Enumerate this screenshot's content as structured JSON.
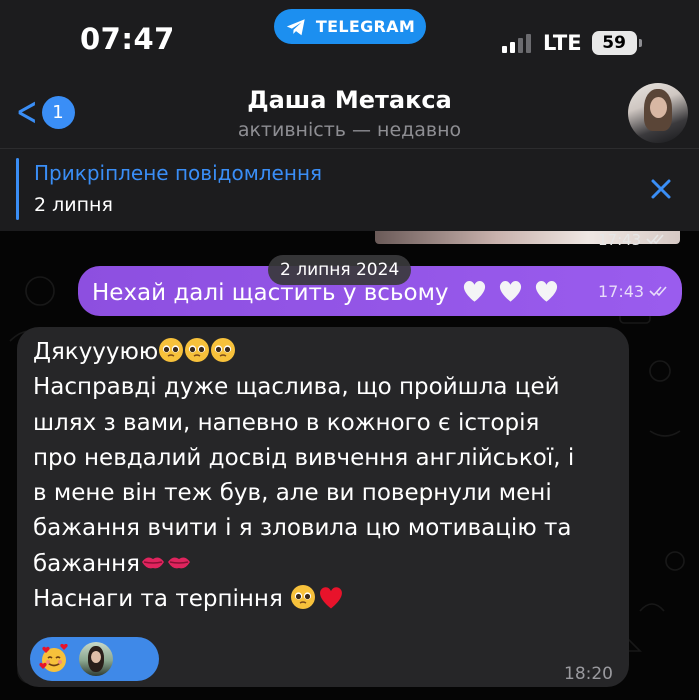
{
  "status_bar": {
    "time": "07:47",
    "app_pill": "TELEGRAM",
    "network": "LTE",
    "battery": "59"
  },
  "header": {
    "back_badge": "1",
    "title": "Даша Метакса",
    "subtitle": "активність — недавно"
  },
  "pinned": {
    "title": "Прикріплене повідомлення",
    "date": "2 липня"
  },
  "chat": {
    "prev_media_time": "17:43",
    "date_separator": "2 липня 2024",
    "outgoing": {
      "text": "Нехай далі щастить у всьому",
      "emoji": [
        "white-heart",
        "white-heart",
        "white-heart"
      ],
      "time": "17:43"
    },
    "incoming": {
      "line1": "Дякуууюю",
      "line1_emoji": [
        "pleading-face",
        "pleading-face",
        "pleading-face"
      ],
      "body": "Насправді дуже щаслива, що пройшла цей\nшлях з вами, напевно в кожного є історія\nпро невдалий досвід вивчення англійської, і\nв мене він теж був, але ви повернули мені\nбажання вчити і я зловила цю мотивацію та\nбажання",
      "body_emoji": [
        "kiss-mark",
        "kiss-mark"
      ],
      "last_line": "Наснаги та терпіння",
      "last_emoji": [
        "pleading-face",
        "red-heart"
      ],
      "reaction": "smiling-face-with-hearts",
      "time": "18:20"
    }
  },
  "colors": {
    "accent": "#3a8ef6",
    "outgoing_bubble": "#9455e8",
    "incoming_bubble": "#262628",
    "reaction_pill": "#3f89e8"
  }
}
